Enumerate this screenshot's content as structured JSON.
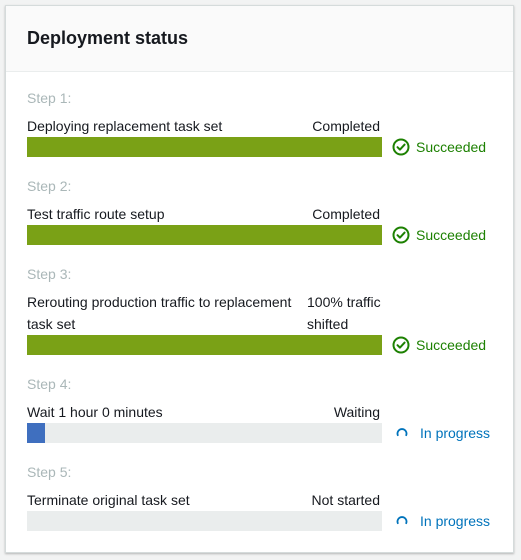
{
  "title": "Deployment status",
  "colors": {
    "success": "#7aa116",
    "success_text": "#1d8102",
    "progress": "#3f6fbf",
    "progress_text": "#0073bb",
    "track": "#eaeded"
  },
  "steps": [
    {
      "label": "Step 1:",
      "task": "Deploying replacement task set",
      "status": "Completed",
      "progress": 1.0,
      "result": "Succeeded",
      "result_icon": "check-circle-icon"
    },
    {
      "label": "Step 2:",
      "task": "Test traffic route setup",
      "status": "Completed",
      "progress": 1.0,
      "result": "Succeeded",
      "result_icon": "check-circle-icon"
    },
    {
      "label": "Step 3:",
      "task": "Rerouting production traffic to replacement task set",
      "status": "100% traffic shifted",
      "progress": 1.0,
      "result": "Succeeded",
      "result_icon": "check-circle-icon"
    },
    {
      "label": "Step 4:",
      "task": "Wait 1 hour 0 minutes",
      "status": "Waiting",
      "progress": 0.05,
      "result": "In progress",
      "result_icon": "spinner-icon"
    },
    {
      "label": "Step 5:",
      "task": "Terminate original task set",
      "status": "Not started",
      "progress": 0,
      "result": "In progress",
      "result_icon": "spinner-icon"
    }
  ]
}
